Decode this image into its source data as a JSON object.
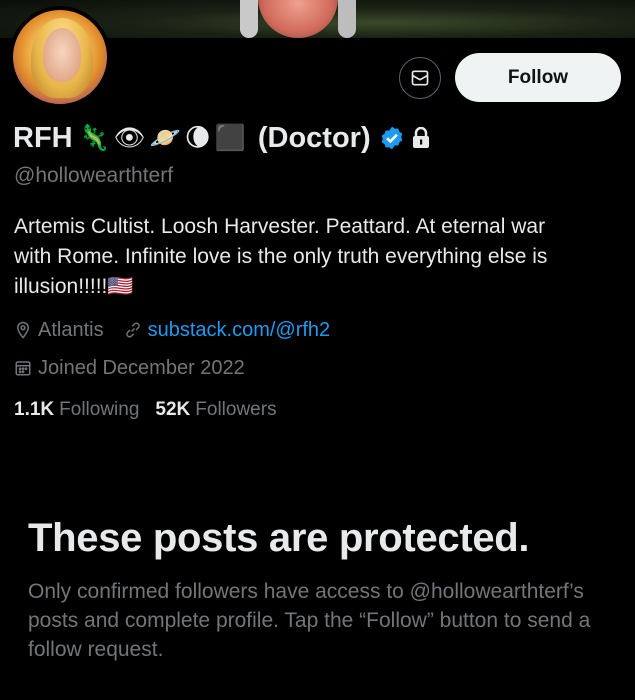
{
  "profile": {
    "name": "RFH",
    "name_suffix": "(Doctor)",
    "emojis": [
      "🦎",
      "👁",
      "🪐",
      "🌘",
      "⬛"
    ],
    "handle": "@hollowearthterf",
    "bio_line1": "Artemis Cultist. Loosh Harvester. Peattard. At eternal war",
    "bio_line2": "with Rome. Infinite love is the only truth everything else is",
    "bio_line3": "illusion!!!!!",
    "bio_flag": "🇺🇸",
    "location": "Atlantis",
    "website": "substack.com/@rfh2",
    "joined": "Joined December 2022",
    "following_count": "1.1K",
    "following_label": "Following",
    "followers_count": "52K",
    "followers_label": "Followers"
  },
  "actions": {
    "follow_label": "Follow",
    "message_icon": "mail-icon"
  },
  "protected": {
    "title": "These posts are protected.",
    "body": "Only confirmed followers have access to @hollowearthterf’s posts and complete profile. Tap the “Follow” button to send a follow request."
  },
  "colors": {
    "background": "#000000",
    "text": "#e7e9ea",
    "secondary": "#71767b",
    "link": "#1d9bf0",
    "verified": "#1d9bf0",
    "button_bg": "#eff3f4"
  }
}
